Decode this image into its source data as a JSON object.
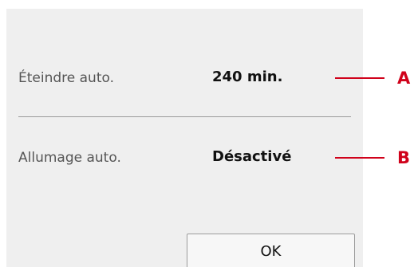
{
  "settings": {
    "rows": [
      {
        "label": "Éteindre auto.",
        "value": "240 min."
      },
      {
        "label": "Allumage auto.",
        "value": "Désactivé"
      }
    ],
    "ok_label": "OK"
  },
  "callouts": [
    "A",
    "B"
  ],
  "colors": {
    "screen_background": "#efefef",
    "callout_accent": "#d0021b",
    "divider": "#9a9a9a"
  }
}
